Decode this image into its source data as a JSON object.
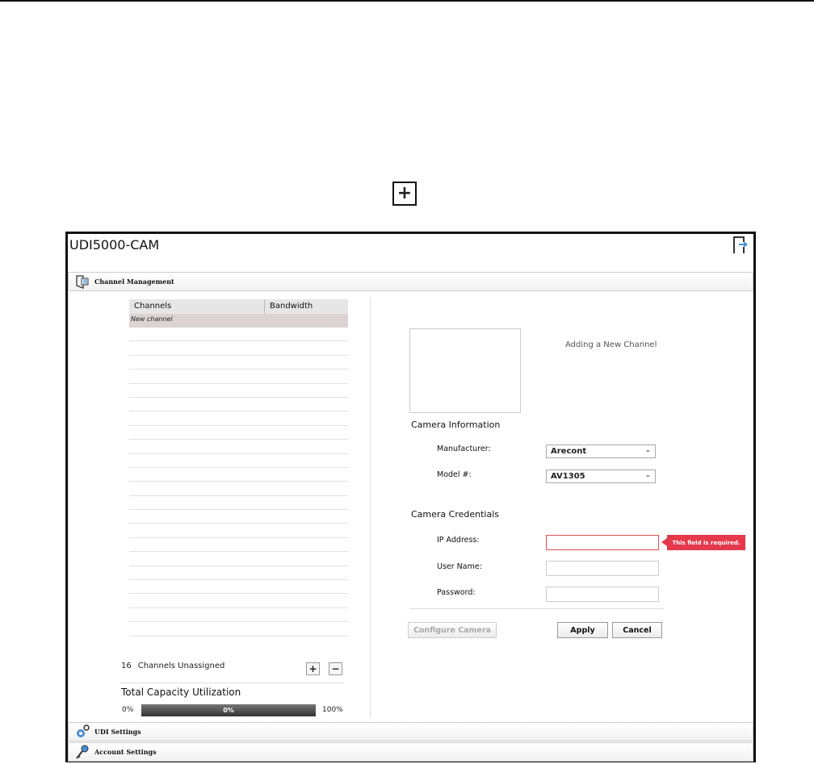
{
  "legend": {
    "plus_symbol": "+"
  },
  "app": {
    "title": "UDI5000-CAM",
    "sections": {
      "channel_management": "Channel Management",
      "udi_settings": "UDI Settings",
      "account_settings": "Account Settings"
    }
  },
  "channels": {
    "columns": [
      "Channels",
      "Bandwidth"
    ],
    "new_channel_label": "New channel",
    "unassigned_count": "16",
    "unassigned_label": "Channels Unassigned",
    "add_button": "+",
    "remove_button": "−"
  },
  "capacity": {
    "title": "Total Capacity Utilization",
    "min_label": "0%",
    "value_label": "0%",
    "max_label": "100%",
    "value": 0
  },
  "form": {
    "heading": "Adding a New Channel",
    "camera_information": "Camera Information",
    "manufacturer_label": "Manufacturer:",
    "manufacturer_value": "Arecont",
    "model_label": "Model #:",
    "model_value": "AV1305",
    "camera_credentials": "Camera Credentials",
    "ip_label": "IP Address:",
    "ip_value": "",
    "user_label": "User Name:",
    "user_value": "",
    "password_label": "Password:",
    "password_value": "",
    "error_message": "This field is required.",
    "configure_button": "Configure Camera",
    "apply_button": "Apply",
    "cancel_button": "Cancel"
  }
}
